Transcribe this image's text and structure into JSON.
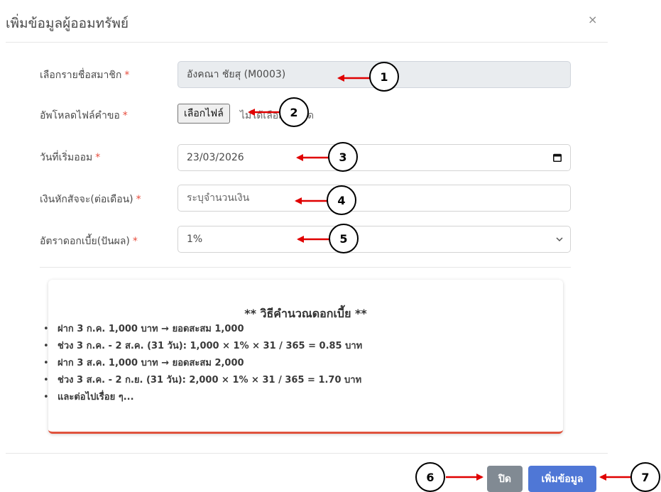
{
  "modal": {
    "title": "เพิ่มข้อมูลผู้ออมทรัพย์",
    "close_icon": "×"
  },
  "form": {
    "member": {
      "label": "เลือกรายชื่อสมาชิก",
      "required": "*",
      "value": "อังคณา ชัยสุ (M0003)"
    },
    "file": {
      "label": "อัพโหลดไฟล์คำขอ",
      "required": "*",
      "button": "เลือกไฟล์",
      "status": "ไม่ได้เลือกไฟล์ใด"
    },
    "start_date": {
      "label": "วันที่เริ่มออม",
      "required": "*",
      "value": "23/03/2026",
      "icon": "calendar-icon"
    },
    "deduction": {
      "label": "เงินหักสัจจะ(ต่อเดือน)",
      "required": "*",
      "placeholder": "ระบุจำนวนเงิน"
    },
    "rate": {
      "label": "อัตราดอกเบี้ย(ปันผล)",
      "required": "*",
      "selected": "1%",
      "icon": "chevron-down-icon"
    }
  },
  "calc": {
    "title": "** วิธีคำนวณดอกเบี้ย **",
    "items": [
      "ฝาก 3 ก.ค. 1,000 บาท → ยอดสะสม 1,000",
      "ช่วง 3 ก.ค. - 2 ส.ค. (31 วัน): 1,000 × 1% × 31 / 365 = 0.85 บาท",
      "ฝาก 3 ส.ค. 1,000 บาท → ยอดสะสม 2,000",
      "ช่วง 3 ส.ค. - 2 ก.ย. (31 วัน): 2,000 × 1% × 31 / 365 = 1.70 บาท",
      "และต่อไปเรื่อย ๆ..."
    ]
  },
  "footer": {
    "close_label": "ปิด",
    "submit_label": "เพิ่มข้อมูล"
  },
  "annotations": [
    "1",
    "2",
    "3",
    "4",
    "5",
    "6",
    "7"
  ],
  "colors": {
    "primary": "#4f77d6",
    "secondary": "#818a93",
    "accent": "#e0533d",
    "arrow": "#e00000"
  }
}
